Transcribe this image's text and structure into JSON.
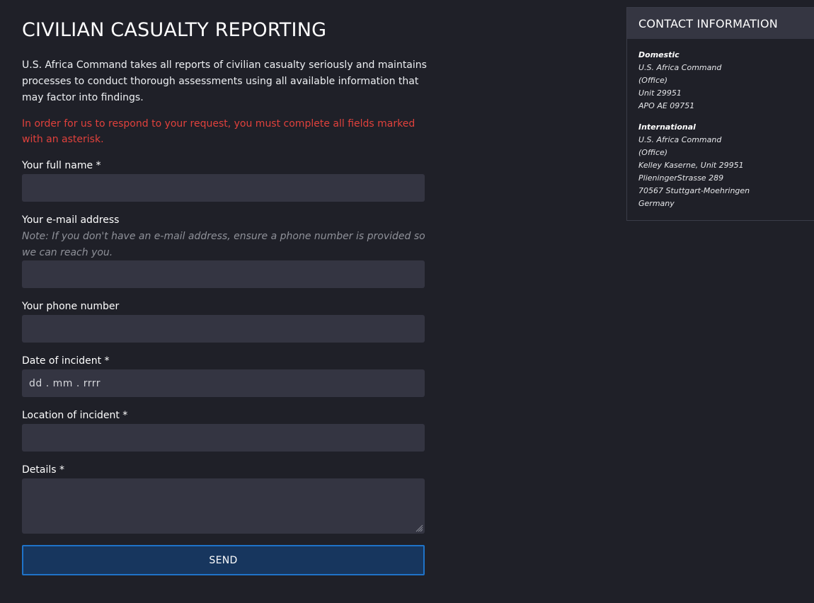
{
  "page": {
    "title": "CIVILIAN CASUALTY REPORTING",
    "intro": "U.S. Africa Command takes all reports of civilian casualty seriously and maintains processes to conduct thorough assessments using all available information that may factor into findings.",
    "warning": "In order for us to respond to your request, you must complete all fields marked with an asterisk."
  },
  "form": {
    "full_name": {
      "label": "Your full name *",
      "value": ""
    },
    "email": {
      "label": "Your e-mail address",
      "note": "Note: If you don't have an e-mail address, ensure a phone number is provided so we can reach you.",
      "value": ""
    },
    "phone": {
      "label": "Your phone number",
      "value": ""
    },
    "date": {
      "label": "Date of incident *",
      "placeholder": "dd . mm . rrrr"
    },
    "location": {
      "label": "Location of incident *",
      "value": ""
    },
    "details": {
      "label": "Details *",
      "value": ""
    },
    "send_label": "SEND"
  },
  "contact": {
    "title": "CONTACT INFORMATION",
    "domestic": {
      "heading": "Domestic",
      "lines": [
        "U.S. Africa Command",
        "(Office)",
        "Unit 29951",
        "APO AE 09751"
      ]
    },
    "international": {
      "heading": "International",
      "lines": [
        "U.S. Africa Command",
        "(Office)",
        "Kelley Kaserne, Unit 29951",
        "PlieningerStrasse 289",
        "70567 Stuttgart-Moehringen",
        "Germany"
      ]
    }
  },
  "colors": {
    "background": "#1f2028",
    "input_background": "#343542",
    "warning": "#e0413c",
    "button_background": "#17365e",
    "button_border": "#1f73c8"
  }
}
